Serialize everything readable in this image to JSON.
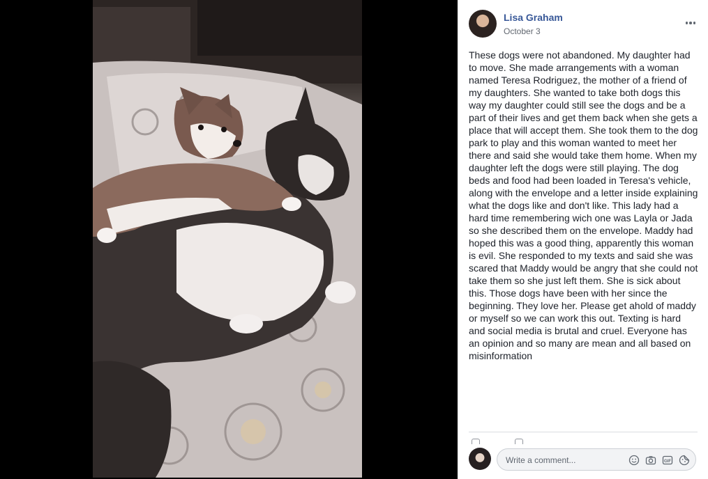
{
  "post": {
    "author_name": "Lisa Graham",
    "date": "October 3",
    "body": "These dogs were not abandoned. My daughter had to move. She made arrangements with a woman named Teresa Rodriguez, the mother of a friend of my daughters. She wanted to take both dogs this way my daughter could still see the dogs and be a part of their lives and get them back when she gets a place that will accept them. She took them to the dog park to play and this woman wanted to meet her there and said she would take them home. When my daughter left the dogs were still playing. The dog beds and food had been loaded in Teresa's vehicle, along with the envelope and a letter inside explaining what the dogs like and don't like. This lady had a hard time remembering wich one was Layla or Jada so she described them on the envelope. Maddy had hoped this was a good thing, apparently this woman is evil. She responded to my texts and said she was scared that Maddy would be angry that she could not take them so she just left them. She is sick about this. Those dogs have been with her since the beginning. They love her. Please get ahold of maddy or myself so we can work this out. Texting is hard and social media is brutal and cruel. Everyone has an opinion and so many are mean and all based on misinformation"
  },
  "comment_box": {
    "placeholder": "Write a comment...",
    "icons": [
      "emoji-icon",
      "camera-icon",
      "gif-icon",
      "sticker-icon"
    ]
  },
  "photo": {
    "subject": "two husky dogs lying on a patterned couch"
  },
  "colors": {
    "author_link": "#385898",
    "meta_text": "#616770",
    "body_text": "#1d2129",
    "viewer_bg": "#000000"
  }
}
